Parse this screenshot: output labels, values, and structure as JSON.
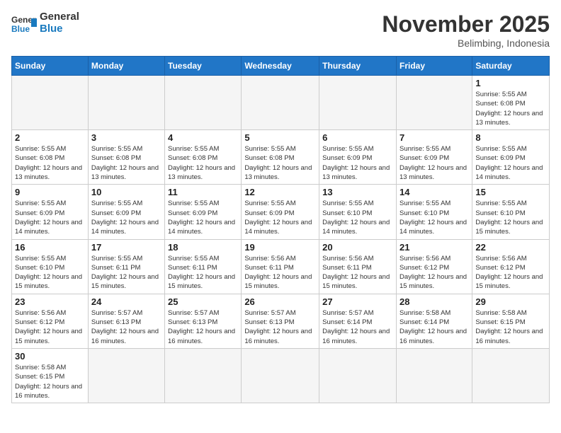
{
  "header": {
    "logo_general": "General",
    "logo_blue": "Blue",
    "month": "November 2025",
    "location": "Belimbing, Indonesia"
  },
  "days_of_week": [
    "Sunday",
    "Monday",
    "Tuesday",
    "Wednesday",
    "Thursday",
    "Friday",
    "Saturday"
  ],
  "weeks": [
    [
      {
        "day": "",
        "info": ""
      },
      {
        "day": "",
        "info": ""
      },
      {
        "day": "",
        "info": ""
      },
      {
        "day": "",
        "info": ""
      },
      {
        "day": "",
        "info": ""
      },
      {
        "day": "",
        "info": ""
      },
      {
        "day": "1",
        "info": "Sunrise: 5:55 AM\nSunset: 6:08 PM\nDaylight: 12 hours and 13 minutes."
      }
    ],
    [
      {
        "day": "2",
        "info": "Sunrise: 5:55 AM\nSunset: 6:08 PM\nDaylight: 12 hours and 13 minutes."
      },
      {
        "day": "3",
        "info": "Sunrise: 5:55 AM\nSunset: 6:08 PM\nDaylight: 12 hours and 13 minutes."
      },
      {
        "day": "4",
        "info": "Sunrise: 5:55 AM\nSunset: 6:08 PM\nDaylight: 12 hours and 13 minutes."
      },
      {
        "day": "5",
        "info": "Sunrise: 5:55 AM\nSunset: 6:08 PM\nDaylight: 12 hours and 13 minutes."
      },
      {
        "day": "6",
        "info": "Sunrise: 5:55 AM\nSunset: 6:09 PM\nDaylight: 12 hours and 13 minutes."
      },
      {
        "day": "7",
        "info": "Sunrise: 5:55 AM\nSunset: 6:09 PM\nDaylight: 12 hours and 13 minutes."
      },
      {
        "day": "8",
        "info": "Sunrise: 5:55 AM\nSunset: 6:09 PM\nDaylight: 12 hours and 14 minutes."
      }
    ],
    [
      {
        "day": "9",
        "info": "Sunrise: 5:55 AM\nSunset: 6:09 PM\nDaylight: 12 hours and 14 minutes."
      },
      {
        "day": "10",
        "info": "Sunrise: 5:55 AM\nSunset: 6:09 PM\nDaylight: 12 hours and 14 minutes."
      },
      {
        "day": "11",
        "info": "Sunrise: 5:55 AM\nSunset: 6:09 PM\nDaylight: 12 hours and 14 minutes."
      },
      {
        "day": "12",
        "info": "Sunrise: 5:55 AM\nSunset: 6:09 PM\nDaylight: 12 hours and 14 minutes."
      },
      {
        "day": "13",
        "info": "Sunrise: 5:55 AM\nSunset: 6:10 PM\nDaylight: 12 hours and 14 minutes."
      },
      {
        "day": "14",
        "info": "Sunrise: 5:55 AM\nSunset: 6:10 PM\nDaylight: 12 hours and 14 minutes."
      },
      {
        "day": "15",
        "info": "Sunrise: 5:55 AM\nSunset: 6:10 PM\nDaylight: 12 hours and 15 minutes."
      }
    ],
    [
      {
        "day": "16",
        "info": "Sunrise: 5:55 AM\nSunset: 6:10 PM\nDaylight: 12 hours and 15 minutes."
      },
      {
        "day": "17",
        "info": "Sunrise: 5:55 AM\nSunset: 6:11 PM\nDaylight: 12 hours and 15 minutes."
      },
      {
        "day": "18",
        "info": "Sunrise: 5:55 AM\nSunset: 6:11 PM\nDaylight: 12 hours and 15 minutes."
      },
      {
        "day": "19",
        "info": "Sunrise: 5:56 AM\nSunset: 6:11 PM\nDaylight: 12 hours and 15 minutes."
      },
      {
        "day": "20",
        "info": "Sunrise: 5:56 AM\nSunset: 6:11 PM\nDaylight: 12 hours and 15 minutes."
      },
      {
        "day": "21",
        "info": "Sunrise: 5:56 AM\nSunset: 6:12 PM\nDaylight: 12 hours and 15 minutes."
      },
      {
        "day": "22",
        "info": "Sunrise: 5:56 AM\nSunset: 6:12 PM\nDaylight: 12 hours and 15 minutes."
      }
    ],
    [
      {
        "day": "23",
        "info": "Sunrise: 5:56 AM\nSunset: 6:12 PM\nDaylight: 12 hours and 15 minutes."
      },
      {
        "day": "24",
        "info": "Sunrise: 5:57 AM\nSunset: 6:13 PM\nDaylight: 12 hours and 16 minutes."
      },
      {
        "day": "25",
        "info": "Sunrise: 5:57 AM\nSunset: 6:13 PM\nDaylight: 12 hours and 16 minutes."
      },
      {
        "day": "26",
        "info": "Sunrise: 5:57 AM\nSunset: 6:13 PM\nDaylight: 12 hours and 16 minutes."
      },
      {
        "day": "27",
        "info": "Sunrise: 5:57 AM\nSunset: 6:14 PM\nDaylight: 12 hours and 16 minutes."
      },
      {
        "day": "28",
        "info": "Sunrise: 5:58 AM\nSunset: 6:14 PM\nDaylight: 12 hours and 16 minutes."
      },
      {
        "day": "29",
        "info": "Sunrise: 5:58 AM\nSunset: 6:15 PM\nDaylight: 12 hours and 16 minutes."
      }
    ],
    [
      {
        "day": "30",
        "info": "Sunrise: 5:58 AM\nSunset: 6:15 PM\nDaylight: 12 hours and 16 minutes."
      },
      {
        "day": "",
        "info": ""
      },
      {
        "day": "",
        "info": ""
      },
      {
        "day": "",
        "info": ""
      },
      {
        "day": "",
        "info": ""
      },
      {
        "day": "",
        "info": ""
      },
      {
        "day": "",
        "info": ""
      }
    ]
  ]
}
